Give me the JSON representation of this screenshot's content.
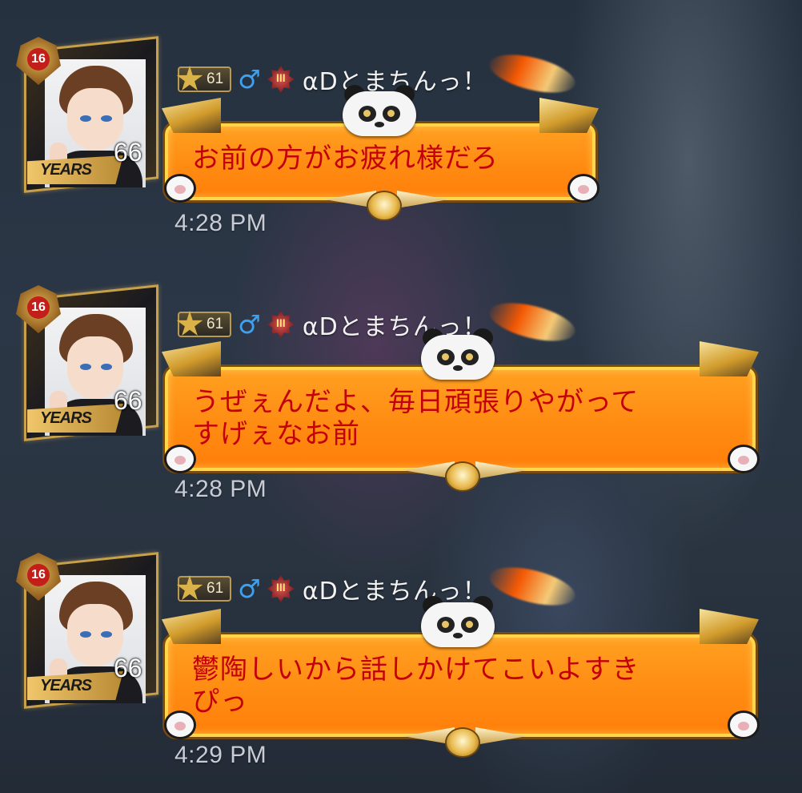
{
  "messages": [
    {
      "avatar": {
        "rank": "16",
        "years": "YEARS",
        "level": "66"
      },
      "user": {
        "level": "61",
        "gender_icon": "♂",
        "title_badge": "III",
        "nickname": "αDとまちんっ！"
      },
      "text": "お前の方がお疲れ様だろ",
      "time": "4:28 PM"
    },
    {
      "avatar": {
        "rank": "16",
        "years": "YEARS",
        "level": "66"
      },
      "user": {
        "level": "61",
        "gender_icon": "♂",
        "title_badge": "III",
        "nickname": "αDとまちんっ！"
      },
      "text": "うぜぇんだよ、毎日頑張りやがって\nすげぇなお前",
      "time": "4:28 PM"
    },
    {
      "avatar": {
        "rank": "16",
        "years": "YEARS",
        "level": "66"
      },
      "user": {
        "level": "61",
        "gender_icon": "♂",
        "title_badge": "III",
        "nickname": "αDとまちんっ！"
      },
      "text": "鬱陶しいから話しかけてこいよすき\nぴっ",
      "time": "4:29 PM"
    }
  ],
  "colors": {
    "bubble_fill": "#ff8c12",
    "bubble_border": "#ffd54a",
    "message_text": "#c4000a",
    "gender_icon": "#3fa0f0",
    "timestamp": "#c9ccd4"
  }
}
